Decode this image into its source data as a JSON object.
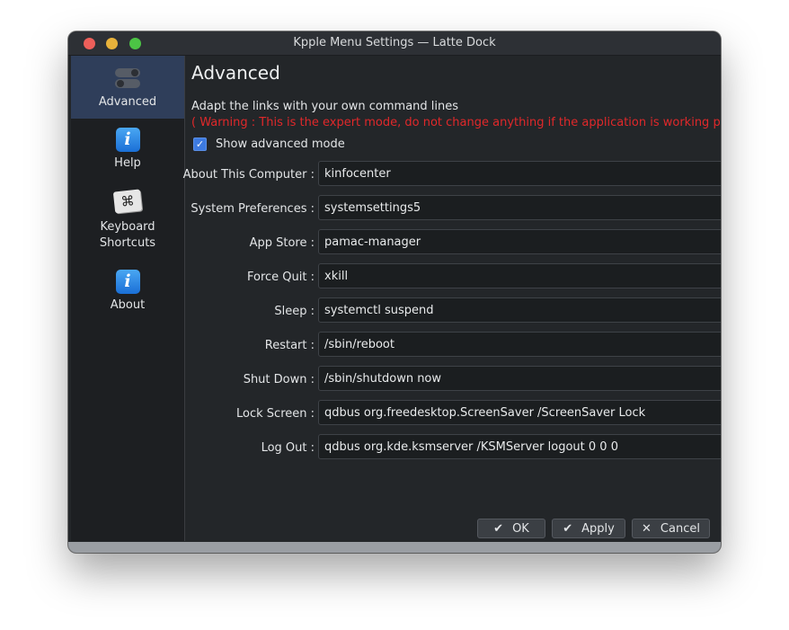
{
  "window": {
    "title": "Kpple Menu Settings — Latte Dock"
  },
  "sidebar": {
    "items": [
      {
        "label": "Advanced",
        "icon": "toggle-switches-icon",
        "active": true
      },
      {
        "label": "Help",
        "icon": "info-icon"
      },
      {
        "label": "Keyboard Shortcuts",
        "label_line1": "Keyboard",
        "label_line2": "Shortcuts",
        "icon": "keyboard-command-icon"
      },
      {
        "label": "About",
        "icon": "info-icon"
      }
    ]
  },
  "main": {
    "heading": "Advanced",
    "description": "Adapt the links with your own command lines",
    "warning": "( Warning : This is the expert mode, do not change anything if the application is working properly )",
    "show_advanced": {
      "label": "Show advanced mode",
      "checked": true
    },
    "fields": [
      {
        "label": "About This Computer :",
        "value": "kinfocenter"
      },
      {
        "label": "System Preferences :",
        "value": "systemsettings5"
      },
      {
        "label": "App Store :",
        "value": "pamac-manager"
      },
      {
        "label": "Force Quit :",
        "value": "xkill"
      },
      {
        "label": "Sleep :",
        "value": "systemctl suspend"
      },
      {
        "label": "Restart :",
        "value": "/sbin/reboot"
      },
      {
        "label": "Shut Down :",
        "value": "/sbin/shutdown now"
      },
      {
        "label": "Lock Screen :",
        "value": "qdbus org.freedesktop.ScreenSaver /ScreenSaver Lock"
      },
      {
        "label": "Log Out :",
        "value": "qdbus org.kde.ksmserver /KSMServer logout 0 0 0"
      }
    ]
  },
  "buttons": {
    "ok": "OK",
    "apply": "Apply",
    "cancel": "Cancel"
  },
  "colors": {
    "warning": "#e0282a",
    "accent": "#3d7ae0",
    "active_sidebar": "#2f3e5a"
  }
}
